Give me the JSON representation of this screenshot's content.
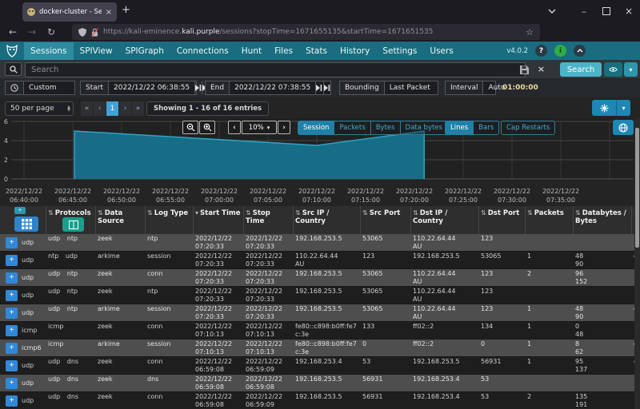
{
  "browser": {
    "tab_title": "docker-cluster - Sessions",
    "url_scheme_host": "https://kali-eminence.",
    "url_domain": "kali.purple",
    "url_path": "/sessions?stopTime=1671655135&startTime=1671651535"
  },
  "glyphs": {
    "plus": "+",
    "close": "×",
    "minimize": "–",
    "back": "←",
    "forward": "→",
    "reload": "↻",
    "star": "☆",
    "menu": "≡",
    "caret_down": "▾",
    "first": "«",
    "prev": "‹",
    "next": "›",
    "last": "»",
    "sort_both": "⇅",
    "sort_desc": "▾",
    "help": "?",
    "spin_up": "▲",
    "spin_down": "▼"
  },
  "nav": {
    "items": [
      "Sessions",
      "SPIView",
      "SPIGraph",
      "Connections",
      "Hunt",
      "Files",
      "Stats",
      "History",
      "Settings",
      "Users"
    ],
    "active_index": 0,
    "version": "v4.0.2"
  },
  "search": {
    "placeholder": "Search",
    "button_label": "Search"
  },
  "timebar": {
    "range_value": "Custom",
    "start_label": "Start",
    "start_value": "2022/12/22 06:38:55",
    "end_label": "End",
    "end_value": "2022/12/22 07:38:55",
    "bounding_label": "Bounding",
    "bounding_value": "Last Packet",
    "interval_label": "Interval",
    "interval_value": "Auto",
    "duration": "01:00:00"
  },
  "pagination": {
    "per_page": "50 per page",
    "page": "1",
    "showing": "Showing 1 - 16 of 16 entries"
  },
  "graph_controls": {
    "zoom_level": "10%",
    "metrics": [
      "Session",
      "Packets",
      "Bytes",
      "Data bytes"
    ],
    "active_metric": "Session",
    "styles": [
      "Lines",
      "Bars"
    ],
    "active_style": "Lines",
    "extra": "Cap Restarts"
  },
  "chart_data": {
    "type": "area",
    "series": "Session",
    "tick_date": "2022/12/22",
    "x_ticks": [
      "06:40:00",
      "06:45:00",
      "06:50:00",
      "06:55:00",
      "07:00:00",
      "07:05:00",
      "07:10:00",
      "07:15:00",
      "07:20:00",
      "07:25:00",
      "07:30:00",
      "07:35:00"
    ],
    "y_ticks": [
      6,
      4,
      2,
      0
    ],
    "ylim": [
      0,
      6
    ],
    "points": [
      {
        "time": "06:45:10",
        "value": 5
      },
      {
        "time": "07:10:00",
        "value": 3.5
      },
      {
        "time": "07:21:00",
        "value": 5
      },
      {
        "time": "07:21:00",
        "value": 0
      }
    ]
  },
  "table": {
    "headers": [
      {
        "label": "Protocols",
        "sort": "both"
      },
      {
        "label": "Data Source",
        "sort": "both"
      },
      {
        "label": "Log Type",
        "sort": "both"
      },
      {
        "label": "Start Time",
        "sort": "desc"
      },
      {
        "label": "Stop Time",
        "sort": "both"
      },
      {
        "label": "Src IP / Country",
        "sort": "both"
      },
      {
        "label": "Src Port",
        "sort": "both"
      },
      {
        "label": "Dst IP / Country",
        "sort": "both"
      },
      {
        "label": "Dst Port",
        "sort": "both"
      },
      {
        "label": "Packets",
        "sort": "both"
      },
      {
        "label": "Databytes / Bytes",
        "sort": "both"
      },
      {
        "label": "",
        "sort": "both"
      }
    ],
    "rows": [
      {
        "proto": "udp",
        "protocols": "udp ntp",
        "source": "zeek",
        "log_type": "ntp",
        "start": [
          "2022/12/22",
          "07:20:33"
        ],
        "stop": [
          "2022/12/22",
          "07:20:33"
        ],
        "src": [
          "192.168.253.5",
          ""
        ],
        "src_port": "53065",
        "dst": [
          "110.22.64.44",
          "AU"
        ],
        "dst_port": "123",
        "packets": "",
        "databytes": "",
        "bytes": "",
        "node": ""
      },
      {
        "proto": "udp",
        "protocols": "ntp udp",
        "source": "arkime",
        "log_type": "session",
        "start": [
          "2022/12/22",
          "07:20:33"
        ],
        "stop": [
          "2022/12/22",
          "07:20:33"
        ],
        "src": [
          "110.22.64.44",
          "AU"
        ],
        "src_port": "123",
        "dst": [
          "192.168.253.5",
          ""
        ],
        "dst_port": "53065",
        "packets": "1",
        "databytes": "48",
        "bytes": "90",
        "node": "e"
      },
      {
        "proto": "udp",
        "protocols": "udp ntp",
        "source": "zeek",
        "log_type": "conn",
        "start": [
          "2022/12/22",
          "07:20:33"
        ],
        "stop": [
          "2022/12/22",
          "07:20:33"
        ],
        "src": [
          "192.168.253.5",
          ""
        ],
        "src_port": "53065",
        "dst": [
          "110.22.64.44",
          "AU"
        ],
        "dst_port": "123",
        "packets": "2",
        "databytes": "96",
        "bytes": "152",
        "node": ""
      },
      {
        "proto": "udp",
        "protocols": "udp ntp",
        "source": "zeek",
        "log_type": "ntp",
        "start": [
          "2022/12/22",
          "07:20:33"
        ],
        "stop": [
          "2022/12/22",
          "07:20:33"
        ],
        "src": [
          "192.168.253.5",
          ""
        ],
        "src_port": "53065",
        "dst": [
          "110.22.64.44",
          "AU"
        ],
        "dst_port": "123",
        "packets": "",
        "databytes": "",
        "bytes": "",
        "node": ""
      },
      {
        "proto": "udp",
        "protocols": "udp ntp",
        "source": "arkime",
        "log_type": "session",
        "start": [
          "2022/12/22",
          "07:20:33"
        ],
        "stop": [
          "2022/12/22",
          "07:20:33"
        ],
        "src": [
          "192.168.253.5",
          ""
        ],
        "src_port": "53065",
        "dst": [
          "110.22.64.44",
          "AU"
        ],
        "dst_port": "123",
        "packets": "1",
        "databytes": "48",
        "bytes": "90",
        "node": "e"
      },
      {
        "proto": "icmp",
        "protocols": "icmp",
        "source": "zeek",
        "log_type": "conn",
        "start": [
          "2022/12/22",
          "07:10:13"
        ],
        "stop": [
          "2022/12/22",
          "07:10:13"
        ],
        "src": [
          "fe80::c898:b0ff:fe7c:3e",
          ""
        ],
        "src_port": "133",
        "dst": [
          "ff02::2",
          ""
        ],
        "dst_port": "134",
        "packets": "1",
        "databytes": "0",
        "bytes": "48",
        "node": ""
      },
      {
        "proto": "icmp6",
        "protocols": "icmp",
        "source": "arkime",
        "log_type": "session",
        "start": [
          "2022/12/22",
          "07:10:13"
        ],
        "stop": [
          "2022/12/22",
          "07:10:13"
        ],
        "src": [
          "fe80::c898:b0ff:fe7c:3e",
          ""
        ],
        "src_port": "0",
        "dst": [
          "ff02::2",
          ""
        ],
        "dst_port": "0",
        "packets": "1",
        "databytes": "8",
        "bytes": "62",
        "node": "e"
      },
      {
        "proto": "udp",
        "protocols": "udp dns",
        "source": "zeek",
        "log_type": "conn",
        "start": [
          "2022/12/22",
          "06:59:08"
        ],
        "stop": [
          "2022/12/22",
          "06:59:09"
        ],
        "src": [
          "192.168.253.4",
          ""
        ],
        "src_port": "53",
        "dst": [
          "192.168.253.5",
          ""
        ],
        "dst_port": "56931",
        "packets": "1",
        "databytes": "95",
        "bytes": "137",
        "node": "e"
      },
      {
        "proto": "udp",
        "protocols": "udp dns",
        "source": "zeek",
        "log_type": "dns",
        "start": [
          "2022/12/22",
          "06:59:08"
        ],
        "stop": [
          "2022/12/22",
          "06:59:08"
        ],
        "src": [
          "192.168.253.5",
          ""
        ],
        "src_port": "56931",
        "dst": [
          "192.168.253.4",
          ""
        ],
        "dst_port": "53",
        "packets": "",
        "databytes": "",
        "bytes": "",
        "node": ""
      },
      {
        "proto": "udp",
        "protocols": "udp dns",
        "source": "zeek",
        "log_type": "conn",
        "start": [
          "2022/12/22",
          "06:59:08"
        ],
        "stop": [
          "2022/12/22",
          "06:59:09"
        ],
        "src": [
          "192.168.253.5",
          ""
        ],
        "src_port": "56931",
        "dst": [
          "192.168.253.4",
          ""
        ],
        "dst_port": "53",
        "packets": "2",
        "databytes": "135",
        "bytes": "191",
        "node": ""
      }
    ]
  },
  "colors": {
    "navbar": "#1a6d80",
    "navbar_active": "#2e8ba0",
    "accent_teal": "#2d96ac",
    "search_button": "#4cb4c9",
    "eye_button": "#17707e",
    "expand_button": "#3188d9",
    "grid_button": "#2e83c9",
    "columns_button": "#17a08c",
    "active_page": "#42a1d6",
    "map_button": "#1d87b5",
    "gear_button": "#1d87b5",
    "area_fill": "#176d86",
    "area_line": "#2fa3c5",
    "row_gray": "#4e4e4e",
    "row_dark": "#1e1e1e",
    "duration_text": "#eed9a4"
  }
}
